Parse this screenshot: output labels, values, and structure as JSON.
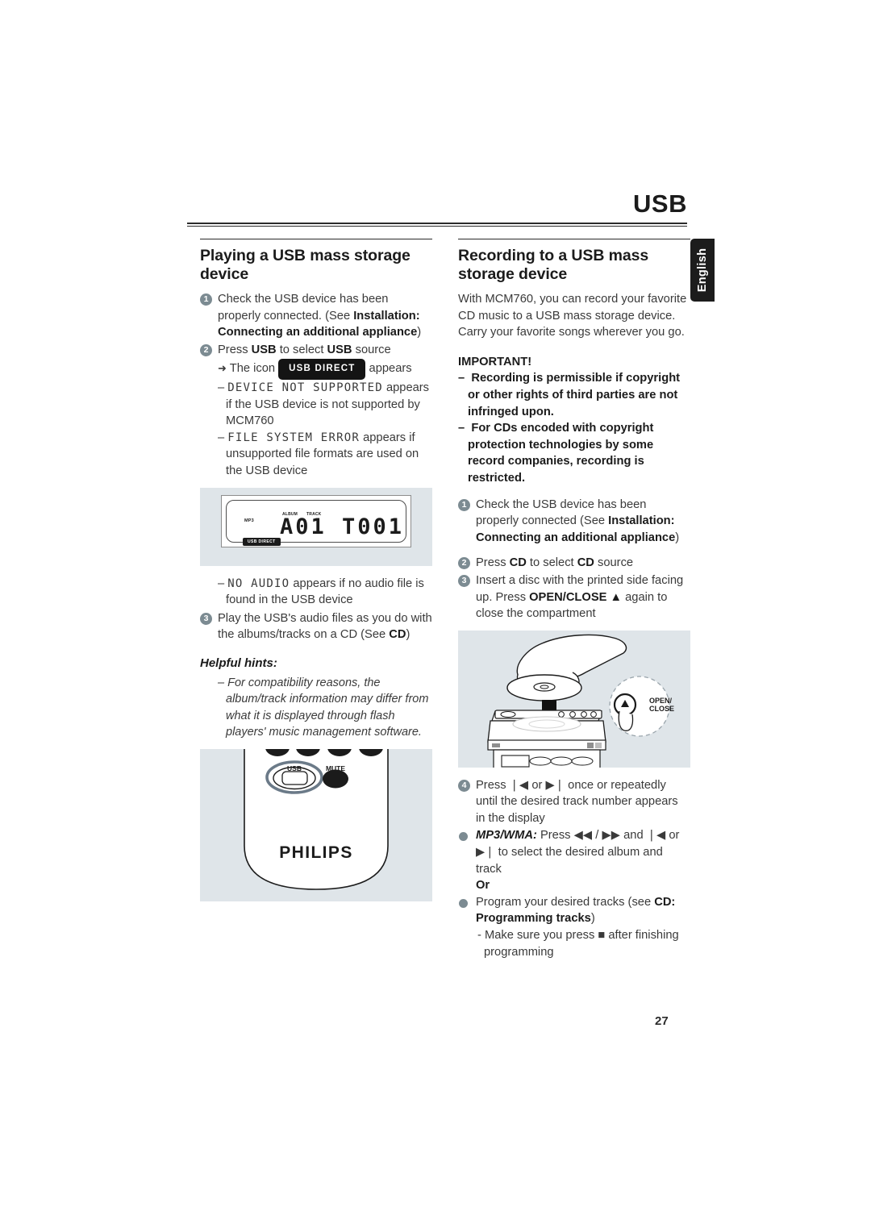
{
  "document": {
    "header_title": "USB",
    "language_tab": "English",
    "page_number": "27"
  },
  "left_column": {
    "section_title": "Playing a USB mass storage device",
    "steps": [
      {
        "num": "1",
        "text_parts": [
          {
            "t": "Check the USB device has been properly connected. (See ",
            "b": false
          },
          {
            "t": "Installation: Connecting an additional appliance",
            "b": true
          },
          {
            "t": ")",
            "b": false
          }
        ]
      },
      {
        "num": "2",
        "text_parts": [
          {
            "t": "Press ",
            "b": false
          },
          {
            "t": "USB",
            "b": true
          },
          {
            "t": " to select ",
            "b": false
          },
          {
            "t": "USB",
            "b": true
          },
          {
            "t": " source",
            "b": false
          }
        ]
      }
    ],
    "step2_sub_icon_line_before": "The icon",
    "step2_badge_label": "USB DIRECT",
    "step2_sub_icon_line_after": "appears",
    "error_device": "DEVICE NOT SUPPORTED",
    "error_device_rest": "appears if the USB device is not supported by MCM760",
    "error_filesystem": "FILE SYSTEM ERROR",
    "error_filesystem_rest": "appears if unsupported file formats are used on the USB device",
    "no_audio_code": "NO AUDIO",
    "no_audio_rest": "appears if no audio file is found in the USB device",
    "step3": {
      "num": "3",
      "text_parts": [
        {
          "t": "Play the USB's audio files as you do with the albums/tracks on a CD (See ",
          "b": false
        },
        {
          "t": "CD",
          "b": true
        },
        {
          "t": ")",
          "b": false
        }
      ]
    },
    "helpful_hints_title": "Helpful hints:",
    "hint_dash": "–",
    "hint_text": "For compatibility reasons, the album/track information may differ from what it is displayed through flash players' music management software.",
    "lcd_display": {
      "mp3_indicator": "MP3",
      "album_label": "ALBUM",
      "track_label": "TRACK",
      "main_readout": "A01 T001",
      "usb_direct_badge": "USB DIRECT"
    },
    "remote_figure": {
      "usb_button_label": "USB",
      "mute_button_label": "MUTE",
      "brand_logo": "PHILIPS"
    }
  },
  "right_column": {
    "section_title": "Recording to a USB mass storage device",
    "intro": "With MCM760, you can record your favorite CD music to a USB mass storage device. Carry your favorite songs wherever you go.",
    "important_title": "IMPORTANT!",
    "important_items": [
      "Recording is permissible if copyright or other rights of third parties are not infringed upon.",
      "For CDs encoded with copyright protection technologies by some record companies,  recording is restricted."
    ],
    "steps": [
      {
        "num": "1",
        "text_parts": [
          {
            "t": "Check the USB device has been properly connected (See ",
            "b": false
          },
          {
            "t": "Installation: Connecting an additional appliance",
            "b": true
          },
          {
            "t": ")",
            "b": false
          }
        ]
      },
      {
        "num": "2",
        "text_parts": [
          {
            "t": "Press ",
            "b": false
          },
          {
            "t": "CD",
            "b": true
          },
          {
            "t": " to select ",
            "b": false
          },
          {
            "t": "CD",
            "b": true
          },
          {
            "t": " source",
            "b": false
          }
        ]
      },
      {
        "num": "3",
        "text_parts": [
          {
            "t": "Insert a disc with the printed side facing up. Press ",
            "b": false
          },
          {
            "t": "OPEN/CLOSE",
            "b": true
          },
          {
            "t": " ▲",
            "b": true
          },
          {
            "t": " again to close the compartment",
            "b": false
          }
        ]
      },
      {
        "num": "4",
        "text_parts": [
          {
            "t": "Press ",
            "b": false
          },
          {
            "t": "❘◀",
            "b": false
          },
          {
            "t": " or ",
            "b": false
          },
          {
            "t": "▶❘",
            "b": false
          },
          {
            "t": "  once or repeatedly until the desired track number appears in the display",
            "b": false
          }
        ]
      }
    ],
    "bullet_mp3wma_label": "MP3/WMA:",
    "bullet_mp3wma_text": "Press ◀◀ / ▶▶ and ❘◀ or ▶❘  to select the desired album and track",
    "or_label": "Or",
    "bullet_program_parts": [
      {
        "t": "Program your desired tracks (see ",
        "b": false
      },
      {
        "t": "CD: Programming tracks",
        "b": true
      },
      {
        "t": ")",
        "b": false
      }
    ],
    "program_note": "- Make sure you press ■ after finishing programming",
    "cd_figure": {
      "callout_line1": "OPEN/",
      "callout_line2": "CLOSE"
    }
  },
  "colors": {
    "figure_background": "#dfe5e9",
    "bullet_gray": "#7c8b92",
    "text": "#3a3a3a",
    "heading": "#1b1b1b",
    "tab_black": "#1c1c1c"
  }
}
